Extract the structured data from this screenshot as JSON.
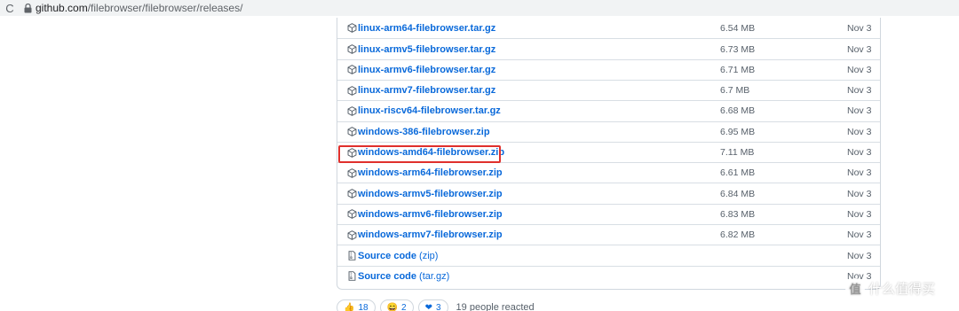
{
  "browser": {
    "url_host": "github.com",
    "url_path": "/filebrowser/filebrowser/releases/"
  },
  "assets": [
    {
      "name": "linux-arm64-filebrowser.tar.gz",
      "size": "6.54 MB",
      "date": "Nov 3",
      "icon": "package-icon"
    },
    {
      "name": "linux-armv5-filebrowser.tar.gz",
      "size": "6.73 MB",
      "date": "Nov 3",
      "icon": "package-icon"
    },
    {
      "name": "linux-armv6-filebrowser.tar.gz",
      "size": "6.71 MB",
      "date": "Nov 3",
      "icon": "package-icon"
    },
    {
      "name": "linux-armv7-filebrowser.tar.gz",
      "size": "6.7 MB",
      "date": "Nov 3",
      "icon": "package-icon"
    },
    {
      "name": "linux-riscv64-filebrowser.tar.gz",
      "size": "6.68 MB",
      "date": "Nov 3",
      "icon": "package-icon"
    },
    {
      "name": "windows-386-filebrowser.zip",
      "size": "6.95 MB",
      "date": "Nov 3",
      "icon": "package-icon"
    },
    {
      "name": "windows-amd64-filebrowser.zip",
      "size": "7.11 MB",
      "date": "Nov 3",
      "icon": "package-icon",
      "highlighted": true
    },
    {
      "name": "windows-arm64-filebrowser.zip",
      "size": "6.61 MB",
      "date": "Nov 3",
      "icon": "package-icon"
    },
    {
      "name": "windows-armv5-filebrowser.zip",
      "size": "6.84 MB",
      "date": "Nov 3",
      "icon": "package-icon"
    },
    {
      "name": "windows-armv6-filebrowser.zip",
      "size": "6.83 MB",
      "date": "Nov 3",
      "icon": "package-icon"
    },
    {
      "name": "windows-armv7-filebrowser.zip",
      "size": "6.82 MB",
      "date": "Nov 3",
      "icon": "package-icon"
    },
    {
      "name": "Source code",
      "suffix": "(zip)",
      "size": "",
      "date": "Nov 3",
      "icon": "file-zip-icon"
    },
    {
      "name": "Source code",
      "suffix": "(tar.gz)",
      "size": "",
      "date": "Nov 3",
      "icon": "file-zip-icon"
    }
  ],
  "reactions": {
    "items": [
      {
        "emoji": "👍",
        "count": "18"
      },
      {
        "emoji": "😄",
        "count": "2"
      },
      {
        "emoji": "❤",
        "count": "3"
      }
    ],
    "summary": "19 people reacted"
  },
  "watermark": {
    "icon_text": "值",
    "text": "什么值得买"
  },
  "colors": {
    "link": "#0969da",
    "highlight_border": "#e0302c",
    "muted": "#57606a"
  }
}
